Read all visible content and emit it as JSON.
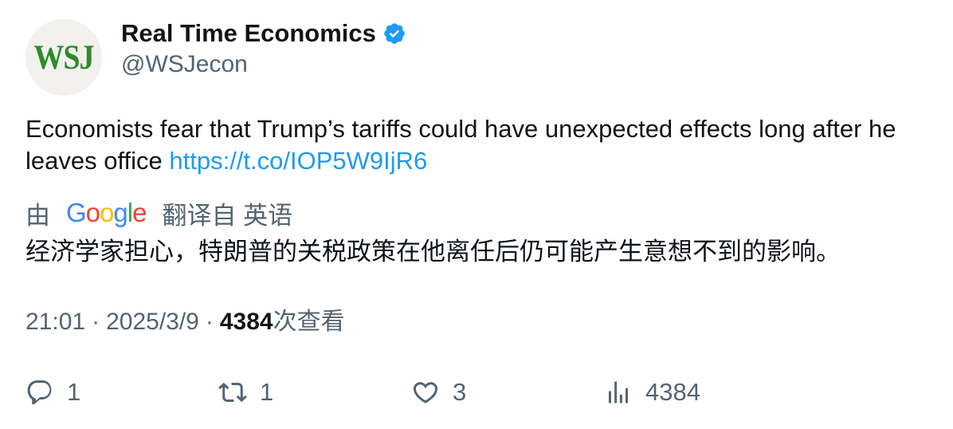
{
  "author": {
    "avatar_text": "WSJ",
    "display_name": "Real Time Economics",
    "handle": "@WSJecon",
    "verified": true
  },
  "tweet": {
    "text": "Economists fear that Trump’s tariffs could have unexpected effects long after he leaves office ",
    "link": "https://t.co/IOP5W9IjR6"
  },
  "translation": {
    "prefix": "由",
    "provider_logo": "Google",
    "suffix": "翻译自 英语",
    "text": "经济学家担心，特朗普的关税政策在他离任后仍可能产生意想不到的影响。"
  },
  "meta": {
    "time": "21:01",
    "separator": "·",
    "date": "2025/3/9",
    "views": "4384",
    "views_label": "次查看"
  },
  "actions": {
    "reply": {
      "icon": "reply-icon",
      "count": "1"
    },
    "retweet": {
      "icon": "retweet-icon",
      "count": "1"
    },
    "like": {
      "icon": "heart-icon",
      "count": "3"
    },
    "views": {
      "icon": "analytics-icon",
      "count": "4384"
    }
  },
  "colors": {
    "link": "#1d9bf0",
    "secondary_text": "#536471",
    "primary_text": "#0f1419",
    "verified": "#1d9bf0",
    "avatar_logo": "#2f8a2a"
  }
}
